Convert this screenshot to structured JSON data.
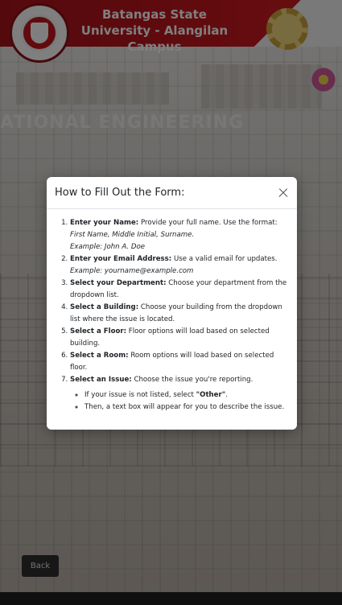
{
  "header": {
    "title": "Batangas State University - Alangilan Campus",
    "background_sign_text": "ATIONAL ENGINEERING"
  },
  "logo": {
    "text": "BATANGAS STATE UNIVERSITY"
  },
  "back_button": {
    "label": "Back"
  },
  "modal": {
    "title": "How to Fill Out the Form:",
    "close_icon": "close-icon",
    "steps": [
      {
        "label": "Enter your Name:",
        "text": " Provide your full name. Use the format:",
        "note1": "First Name, Middle Initial, Surname.",
        "note2": "Example: John A. Doe"
      },
      {
        "label": "Enter your Email Address:",
        "text": " Use a valid email for updates.",
        "note1": "Example: yourname@example.com"
      },
      {
        "label": "Select your Department:",
        "text": " Choose your department from the dropdown list."
      },
      {
        "label": "Select a Building:",
        "text": " Choose your building from the dropdown list where the issue is located."
      },
      {
        "label": "Select a Floor:",
        "text": " Floor options will load based on selected building."
      },
      {
        "label": "Select a Room:",
        "text": " Room options will load based on selected floor."
      },
      {
        "label": "Select an Issue:",
        "text": " Choose the issue you're reporting."
      }
    ],
    "sub_items": {
      "first_prefix": "If your issue is not listed, select ",
      "first_strong": "\"Other\"",
      "first_suffix": ".",
      "second": "Then, a text box will appear for you to describe the issue."
    }
  },
  "colors": {
    "header_red": "#c4161d",
    "overlay": "rgba(0,0,0,0.5)",
    "modal_bg": "#ffffff",
    "back_button_bg": "#2e2e2e"
  }
}
